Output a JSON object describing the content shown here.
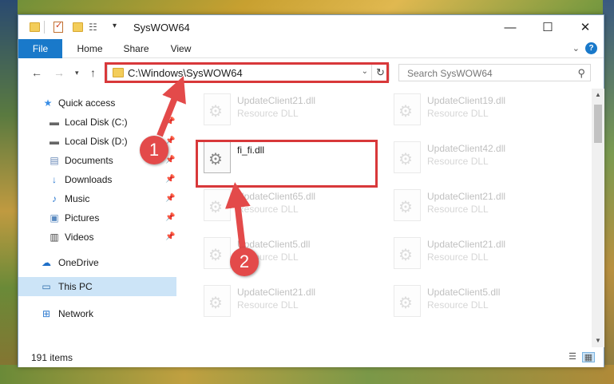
{
  "window": {
    "title": "SysWOW64",
    "controls": {
      "minimize": "—",
      "maximize": "☐",
      "close": "✕"
    }
  },
  "ribbon": {
    "tabs": [
      "File",
      "Home",
      "Share",
      "View"
    ],
    "expand_icon": "chevron-down-icon",
    "help": "?"
  },
  "navigation": {
    "address": "C:\\Windows\\SysWOW64",
    "search_placeholder": "Search SysWOW64"
  },
  "sidebar": {
    "items": [
      {
        "label": "Quick access",
        "icon": "star-icon"
      },
      {
        "label": "Local Disk (C:)",
        "icon": "drive-icon",
        "pinned": true
      },
      {
        "label": "Local Disk (D:)",
        "icon": "drive-icon",
        "pinned": true
      },
      {
        "label": "Documents",
        "icon": "documents-icon",
        "pinned": true
      },
      {
        "label": "Downloads",
        "icon": "download-icon",
        "pinned": true
      },
      {
        "label": "Music",
        "icon": "music-icon",
        "pinned": true
      },
      {
        "label": "Pictures",
        "icon": "pictures-icon",
        "pinned": true
      },
      {
        "label": "Videos",
        "icon": "video-icon",
        "pinned": true
      },
      {
        "label": "OneDrive",
        "icon": "cloud-icon"
      },
      {
        "label": "This PC",
        "icon": "computer-icon",
        "selected": true
      },
      {
        "label": "Network",
        "icon": "network-icon"
      }
    ]
  },
  "files": {
    "left": [
      {
        "name": "UpdateClient21.dll",
        "type": "Resource DLL"
      },
      {
        "name": "fi_fi.dll",
        "type": ""
      },
      {
        "name": "UpdateClient65.dll",
        "type": "Resource DLL"
      },
      {
        "name": "UpdateClient5.dll",
        "type": "Resource DLL"
      },
      {
        "name": "UpdateClient21.dll",
        "type": "Resource DLL"
      }
    ],
    "right": [
      {
        "name": "UpdateClient19.dll",
        "type": "Resource DLL"
      },
      {
        "name": "UpdateClient42.dll",
        "type": "Resource DLL"
      },
      {
        "name": "UpdateClient21.dll",
        "type": "Resource DLL"
      },
      {
        "name": "UpdateClient21.dll",
        "type": "Resource DLL"
      },
      {
        "name": "UpdateClient5.dll",
        "type": "Resource DLL"
      }
    ]
  },
  "status": {
    "item_count": "191 items"
  },
  "annotations": {
    "step1": "1",
    "step2": "2",
    "color": "#d8383a"
  }
}
